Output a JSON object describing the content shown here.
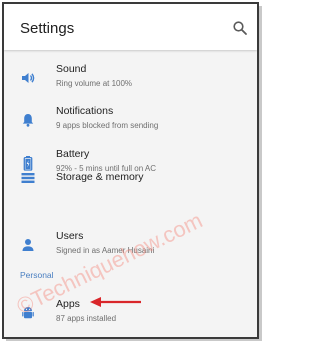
{
  "header": {
    "title": "Settings",
    "search_icon": "search-icon"
  },
  "items": [
    {
      "title": "Sound",
      "subtitle": "Ring volume at 100%",
      "icon": "volume-icon"
    },
    {
      "title": "Notifications",
      "subtitle": "9 apps blocked from sending",
      "icon": "bell-icon"
    },
    {
      "title": "Battery",
      "subtitle": "92% - 5 mins until full on AC",
      "icon": "battery-icon"
    },
    {
      "title": "Storage & memory",
      "subtitle": "",
      "icon": "storage-icon"
    },
    {
      "title": "Users",
      "subtitle": "Signed in as Aamer Husaini",
      "icon": "user-icon"
    }
  ],
  "section": {
    "label": "Personal"
  },
  "apps_item": {
    "title": "Apps",
    "subtitle": "87 apps installed",
    "icon": "android-icon"
  },
  "watermark": {
    "text": "©Techniquehow.com"
  },
  "colors": {
    "accent": "#4a7fc1",
    "icon": "#3f7fcf",
    "arrow": "#d9262a",
    "background": "#f4f4f4"
  }
}
